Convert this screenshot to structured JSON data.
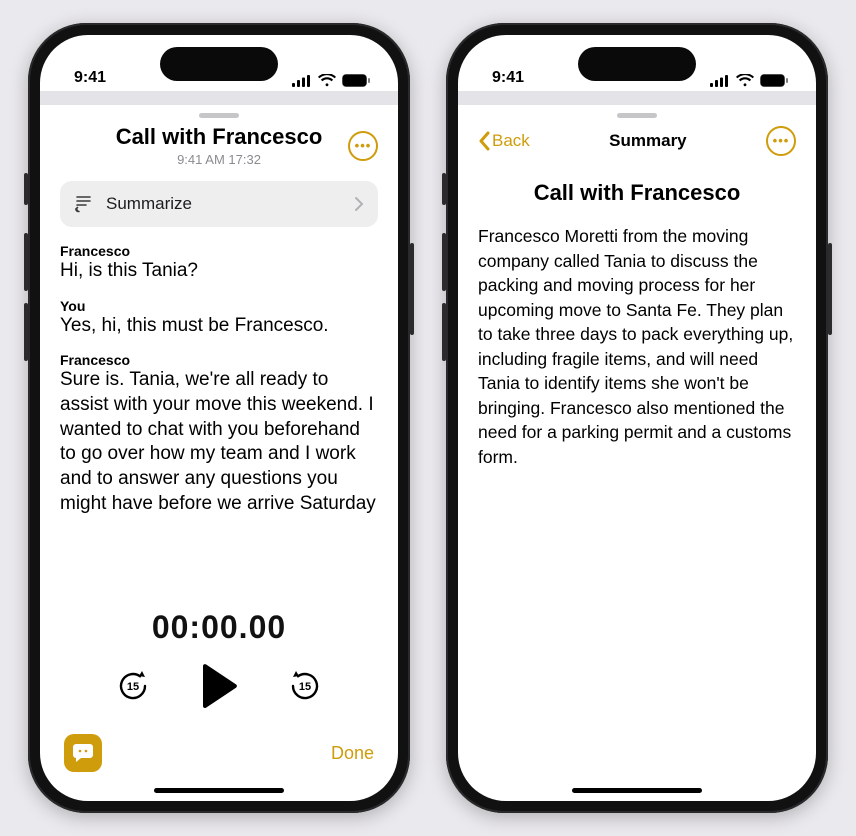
{
  "statusbar": {
    "time": "9:41"
  },
  "transcript_screen": {
    "title": "Call with Francesco",
    "subtitle": "9:41 AM  17:32",
    "summarize_label": "Summarize",
    "messages": [
      {
        "speaker": "Francesco",
        "text": "Hi, is this Tania?"
      },
      {
        "speaker": "You",
        "text": "Yes, hi, this must be Francesco."
      },
      {
        "speaker": "Francesco",
        "text": "Sure is. Tania, we're all ready to assist with your move this weekend. I wanted to chat with you beforehand to go over how my team and I work and to answer any questions you might have before we arrive Saturday"
      }
    ],
    "player_time": "00:00.00",
    "skip_seconds": "15",
    "done_label": "Done"
  },
  "summary_screen": {
    "back_label": "Back",
    "nav_title": "Summary",
    "title": "Call with Francesco",
    "body": "Francesco Moretti from the moving company called Tania to discuss the packing and moving process for her upcoming move to Santa Fe. They plan to take three days to pack everything up, including fragile items, and will need Tania to identify items she won't be bringing. Francesco also mentioned the need for a parking permit and a customs form."
  },
  "colors": {
    "accent": "#cf9c0b"
  }
}
